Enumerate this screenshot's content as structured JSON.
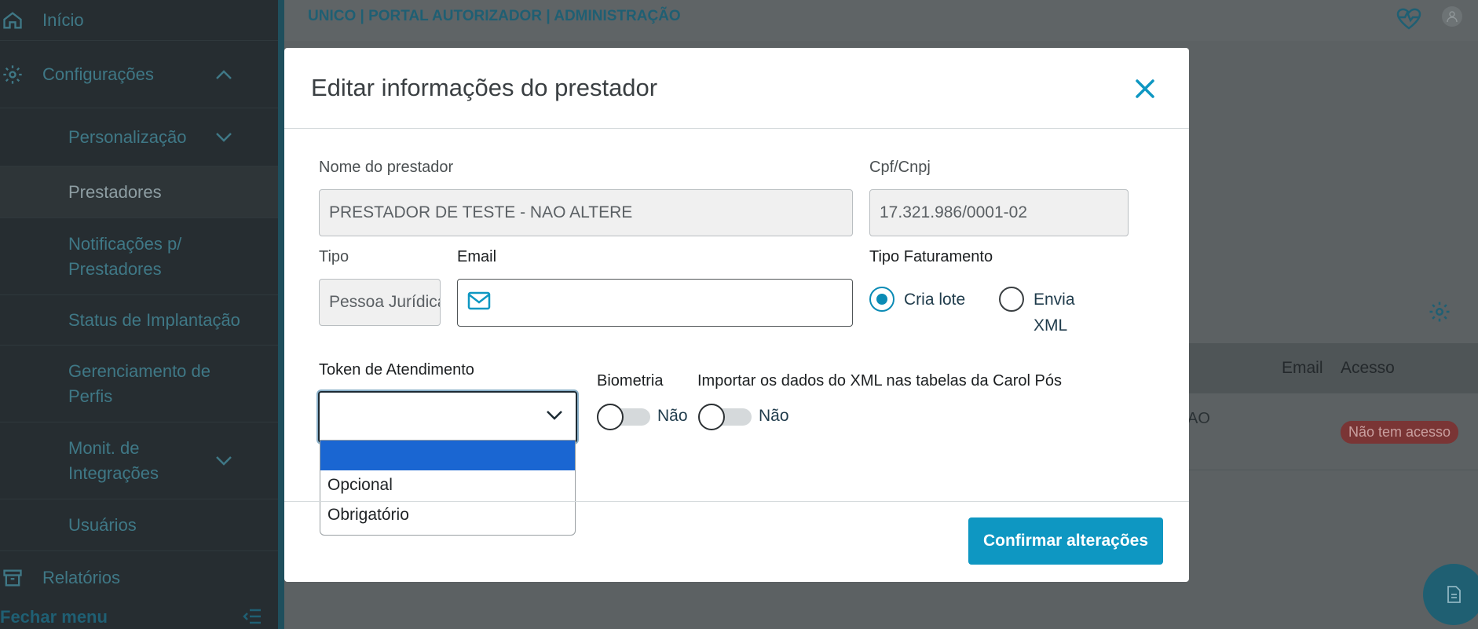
{
  "sidebar": {
    "items": [
      {
        "label": "Início",
        "icon": "home-icon"
      },
      {
        "label": "Configurações",
        "icon": "gear-icon"
      },
      {
        "label": "Personalização"
      },
      {
        "label": "Prestadores"
      },
      {
        "label": "Notificações p/ Prestadores"
      },
      {
        "label": "Status de Implantação"
      },
      {
        "label": "Gerenciamento de Perfis"
      },
      {
        "label": "Monit. de Integrações"
      },
      {
        "label": "Usuários"
      },
      {
        "label": "Relatórios",
        "icon": "archive-icon"
      }
    ],
    "footer_label": "Fechar menu"
  },
  "topbar": {
    "title": "UNICO | PORTAL AUTORIZADOR | ADMINISTRAÇÃO"
  },
  "background_table": {
    "headers": [
      "Email",
      "Acesso"
    ],
    "row_fragment": "AO",
    "badge": "Não tem acesso"
  },
  "modal": {
    "title": "Editar informações do prestador",
    "fields": {
      "nome_label": "Nome do prestador",
      "nome_value": "PRESTADOR DE TESTE - NAO ALTERE",
      "cpf_label": "Cpf/Cnpj",
      "cpf_value": "17.321.986/0001-02",
      "tipo_label": "Tipo",
      "tipo_value": "Pessoa Jurídica",
      "email_label": "Email",
      "email_value": "",
      "faturamento_label": "Tipo Faturamento",
      "faturamento_options": [
        "Cria lote",
        "Envia XML"
      ],
      "faturamento_selected": "Cria lote",
      "token_label": "Token de Atendimento",
      "token_value": "",
      "token_options": [
        "",
        "Opcional",
        "Obrigatório"
      ],
      "biometria_label": "Biometria",
      "biometria_state": "Não",
      "importar_label": "Importar os dados do XML nas tabelas da Carol Pós",
      "importar_state": "Não"
    },
    "confirm_label": "Confirmar alterações"
  },
  "colors": {
    "accent": "#0e97c2",
    "dropdown_highlight": "#1a66d2",
    "sidebar_bg": "#262d31"
  }
}
